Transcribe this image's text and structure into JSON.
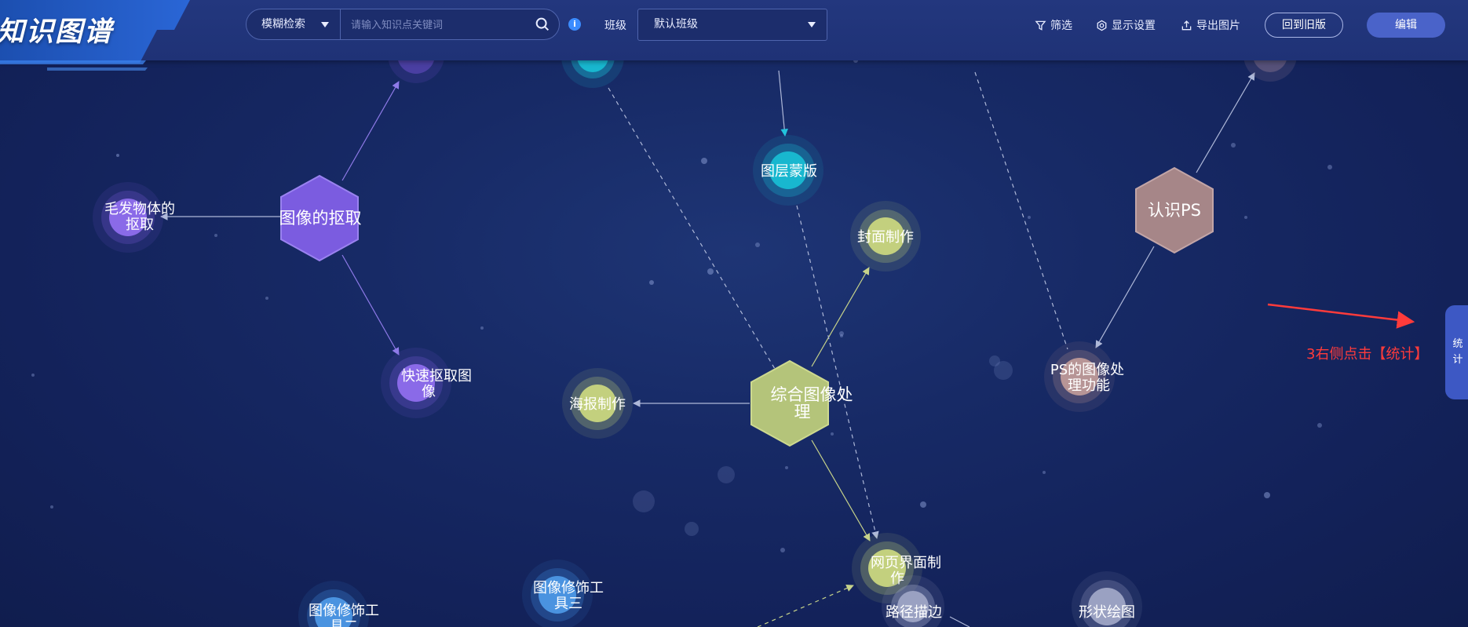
{
  "app": {
    "title": "知识图谱"
  },
  "header": {
    "search": {
      "mode_label": "模糊检索",
      "placeholder": "请输入知识点关键词",
      "value": ""
    },
    "class_filter": {
      "label": "班级",
      "selected": "默认班级"
    },
    "tools": {
      "filter_label": "筛选",
      "display_settings_label": "显示设置",
      "export_image_label": "导出图片"
    },
    "buttons": {
      "back_to_old_label": "回到旧版",
      "edit_label": "编辑"
    }
  },
  "side_panel": {
    "tab_label_line1": "统",
    "tab_label_line2": "计"
  },
  "annotation": {
    "text": "3右侧点击【统计】",
    "color": "#ff3b3b"
  },
  "graph": {
    "nodes": [
      {
        "id": "n_matting",
        "label_lines": [
          "图像的抠取"
        ],
        "shape": "hexagon",
        "color": "#7b5ce0"
      },
      {
        "id": "n_hair",
        "label_lines": [
          "毛发物体的",
          "抠取"
        ],
        "shape": "circle",
        "color": "#7b5ce0"
      },
      {
        "id": "n_quick",
        "label_lines": [
          "快速抠取图",
          "像"
        ],
        "shape": "circle",
        "color": "#7b5ce0"
      },
      {
        "id": "n_layer",
        "label_lines": [
          "图层蒙版"
        ],
        "shape": "circle",
        "color": "#18b7cf"
      },
      {
        "id": "n_cover",
        "label_lines": [
          "封面制作"
        ],
        "shape": "circle",
        "color": "#b8c878"
      },
      {
        "id": "n_poster",
        "label_lines": [
          "海报制作"
        ],
        "shape": "circle",
        "color": "#b8c878"
      },
      {
        "id": "n_composite",
        "label_lines": [
          "综合图像处",
          "理"
        ],
        "shape": "hexagon",
        "color": "#b4c47a"
      },
      {
        "id": "n_web",
        "label_lines": [
          "网页界面制",
          "作"
        ],
        "shape": "circle",
        "color": "#b8c878"
      },
      {
        "id": "n_ps",
        "label_lines": [
          "认识PS"
        ],
        "shape": "hexagon",
        "color": "#a68688"
      },
      {
        "id": "n_psfunc",
        "label_lines": [
          "PS的图像处",
          "理功能"
        ],
        "shape": "circle",
        "color": "#a68688"
      },
      {
        "id": "n_path",
        "label_lines": [
          "路径描边"
        ],
        "shape": "circle",
        "color": "#8a93b8"
      },
      {
        "id": "n_shape",
        "label_lines": [
          "形状绘图"
        ],
        "shape": "circle",
        "color": "#8a93b8"
      },
      {
        "id": "n_retouch3",
        "label_lines": [
          "图像修饰工",
          "具三"
        ],
        "shape": "circle",
        "color": "#3b86d6"
      },
      {
        "id": "n_retouch2",
        "label_lines": [
          "图像修饰工",
          "具二"
        ],
        "shape": "circle",
        "color": "#3b86d6"
      },
      {
        "id": "n_top_purple",
        "label_lines": [],
        "shape": "circle",
        "color": "#6a4fc8"
      },
      {
        "id": "n_top_cyan",
        "label_lines": [],
        "shape": "circle",
        "color": "#18b7cf"
      },
      {
        "id": "n_top_right",
        "label_lines": [],
        "shape": "circle",
        "color": "#8a7690"
      }
    ],
    "edges": [
      {
        "from": "n_matting",
        "to": "n_hair",
        "style": "solid"
      },
      {
        "from": "n_matting",
        "to": "n_quick",
        "style": "solid"
      },
      {
        "from": "n_matting",
        "to": "n_top_purple",
        "style": "solid"
      },
      {
        "from": "n_composite",
        "to": "n_cover",
        "style": "solid"
      },
      {
        "from": "n_composite",
        "to": "n_poster",
        "style": "solid"
      },
      {
        "from": "n_composite",
        "to": "n_web",
        "style": "solid"
      },
      {
        "from": "n_ps",
        "to": "n_psfunc",
        "style": "solid"
      },
      {
        "from": "n_ps",
        "to": "n_top_right",
        "style": "solid"
      },
      {
        "from": "n_top_cyan",
        "to": "n_composite",
        "style": "dashed"
      },
      {
        "from": "n_layer",
        "to": "n_web",
        "style": "dashed"
      }
    ]
  }
}
